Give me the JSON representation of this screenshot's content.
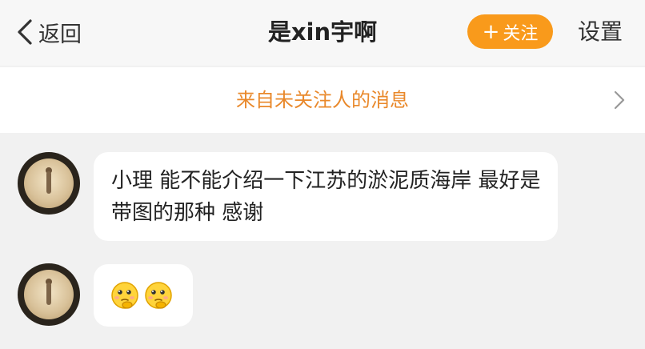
{
  "navbar": {
    "back_label": "返回",
    "title": "是xin宇啊",
    "follow_label": "关注",
    "settings_label": "设置"
  },
  "banner": {
    "text": "来自未关注人的消息"
  },
  "messages": [
    {
      "text": "小理  能不能介绍一下江苏的淤泥质海岸  最好是带图的那种  感谢"
    },
    {
      "emojis": [
        "thinking-face-emoji",
        "thinking-face-emoji"
      ]
    }
  ],
  "colors": {
    "accent": "#f99a1b",
    "banner_text": "#e9882a",
    "background": "#f1f1f1"
  }
}
